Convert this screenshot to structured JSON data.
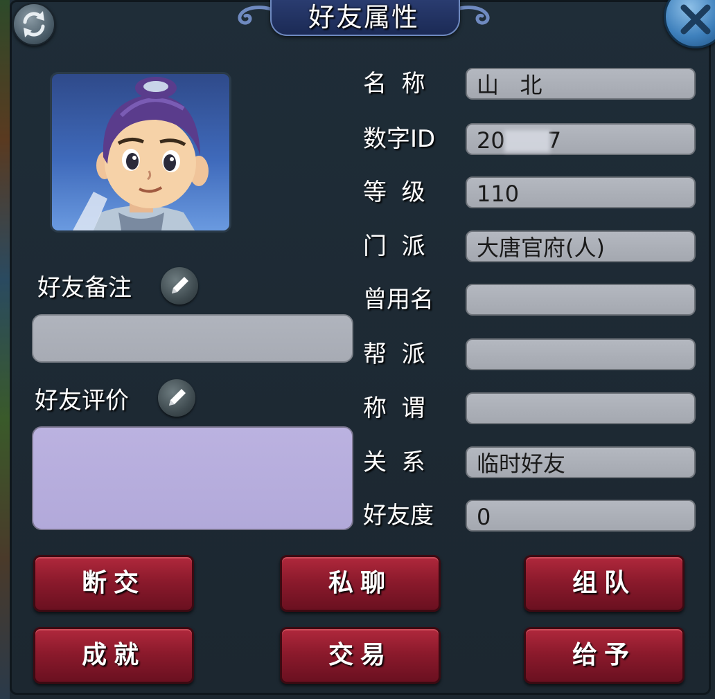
{
  "window": {
    "title": "好友属性"
  },
  "labels": {
    "note": "好友备注",
    "review": "好友评价"
  },
  "attributes": [
    {
      "label": "名  称",
      "value": "山   北"
    },
    {
      "label": "数字ID",
      "value": "20      7"
    },
    {
      "label": "等  级",
      "value": "110"
    },
    {
      "label": "门  派",
      "value": "大唐官府(人)"
    },
    {
      "label": "曾用名",
      "value": ""
    },
    {
      "label": "帮  派",
      "value": ""
    },
    {
      "label": "称  谓",
      "value": ""
    },
    {
      "label": "关  系",
      "value": "临时好友"
    },
    {
      "label": "好友度",
      "value": "0"
    }
  ],
  "actions": {
    "break": "断交",
    "chat": "私聊",
    "team": "组队",
    "achieve": "成就",
    "trade": "交易",
    "give": "给予"
  },
  "colors": {
    "panel_bg": "#1e2a33",
    "field_bg": "#aaaeb6",
    "review_bg": "#b7aedd",
    "button_red": "#8c1a2c"
  }
}
